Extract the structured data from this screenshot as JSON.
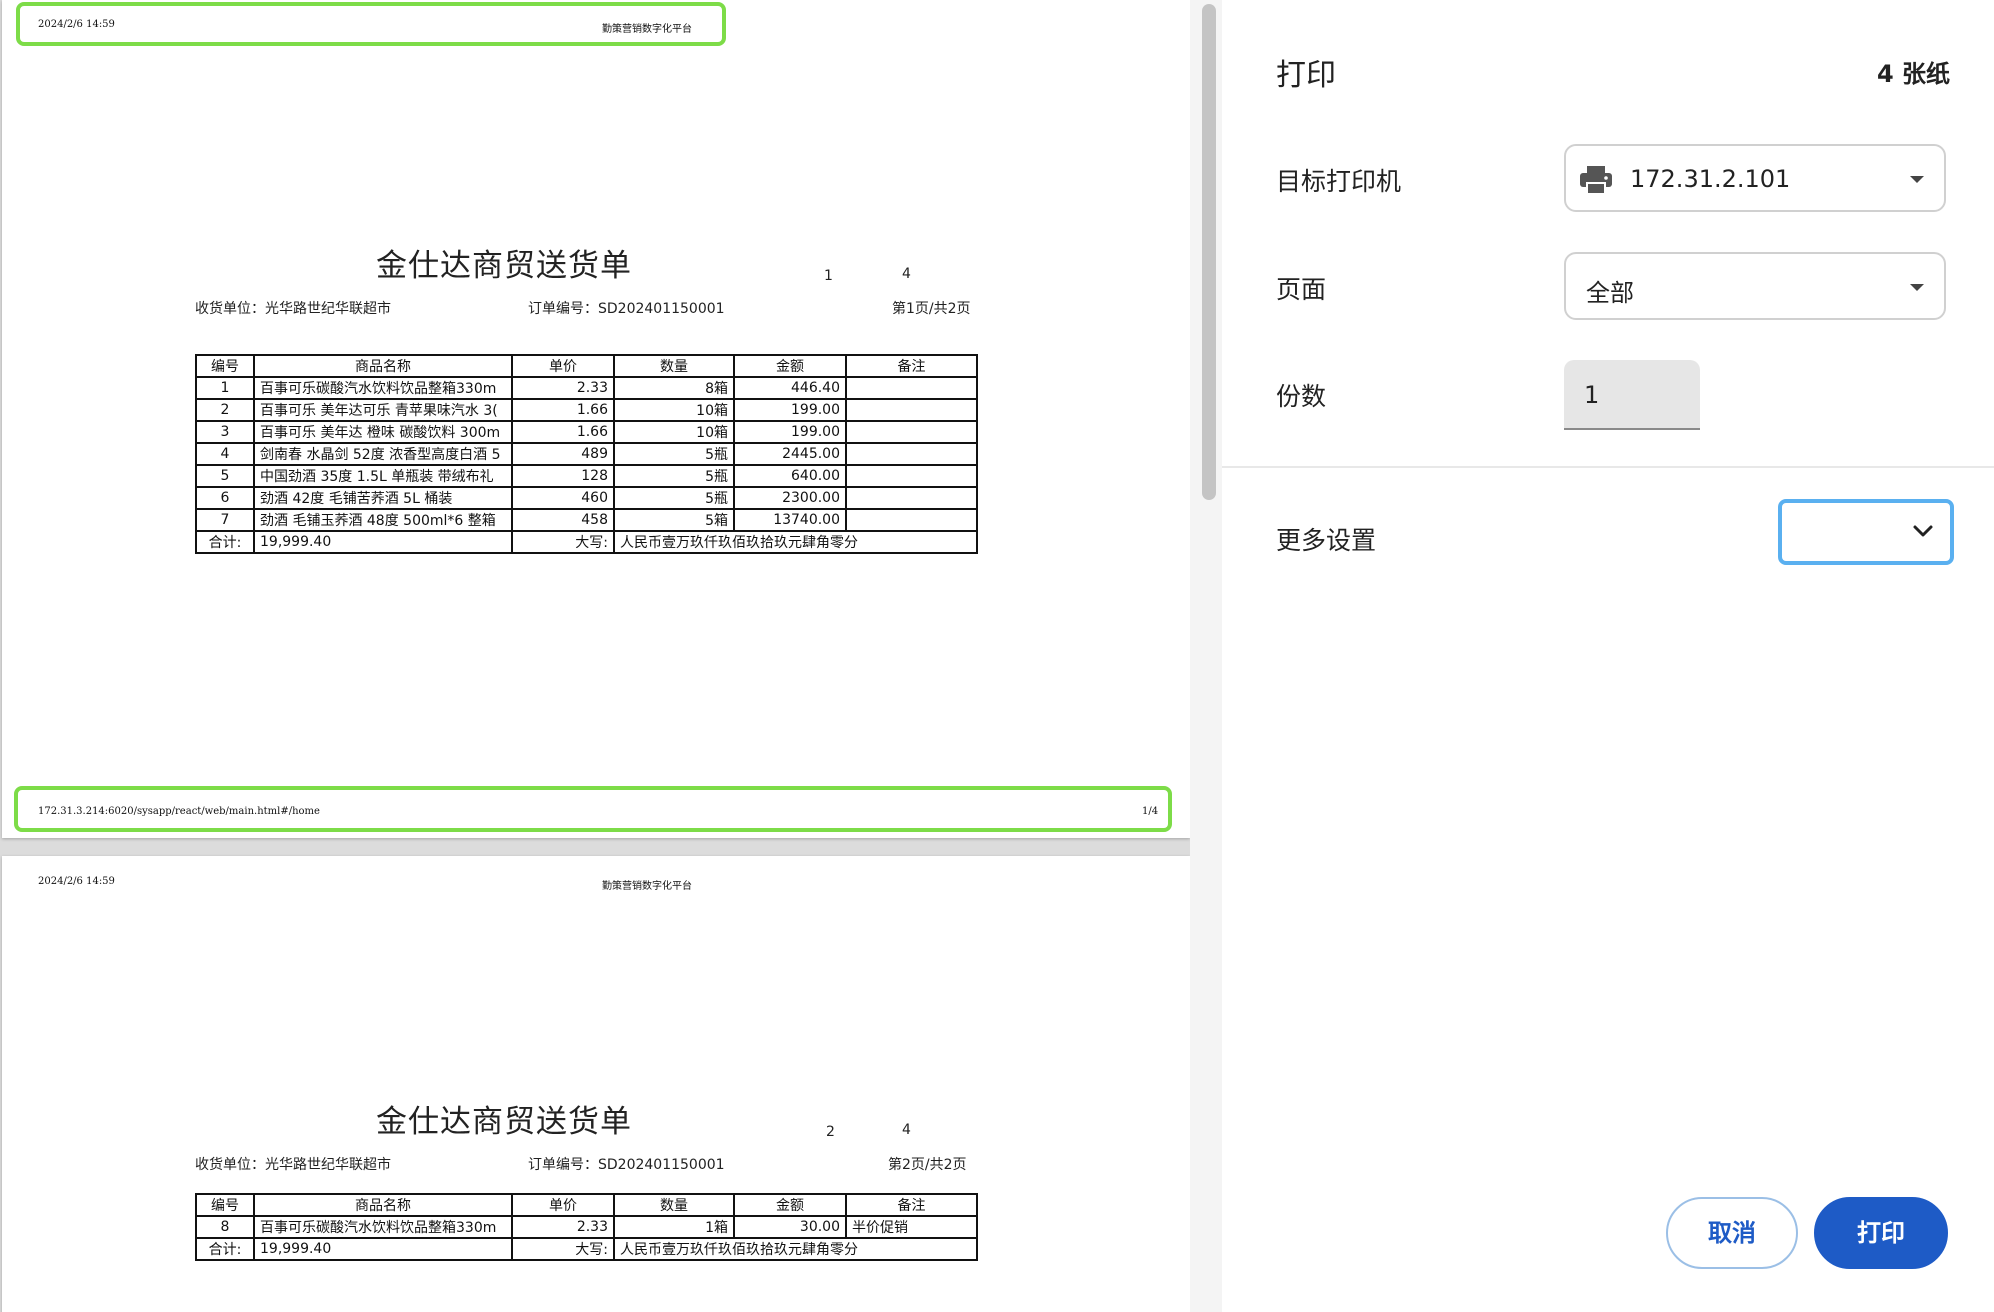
{
  "preview": {
    "pages": [
      {
        "header_date": "2024/2/6 14:59",
        "header_site": "勤策营销数字化平台",
        "title": "金仕达商贸送货单",
        "num_a": "1",
        "num_b": "4",
        "receiver": "收货单位：光华路世纪华联超市",
        "order_no": "订单编号：SD202401150001",
        "page_info": "第1页/共2页",
        "footer_url": "172.31.3.214:6020/sysapp/react/web/main.html#/home",
        "footer_num": "1/4"
      },
      {
        "header_date": "2024/2/6 14:59",
        "header_site": "勤策营销数字化平台",
        "title": "金仕达商贸送货单",
        "num_a": "2",
        "num_b": "4",
        "receiver": "收货单位：光华路世纪华联超市",
        "order_no": "订单编号：SD202401150001",
        "page_info": "第2页/共2页"
      }
    ],
    "table_headers": [
      "编号",
      "商品名称",
      "单价",
      "数量",
      "金额",
      "备注"
    ],
    "rows_page1": [
      [
        "1",
        "百事可乐碳酸汽水饮料饮品整箱330m",
        "2.33",
        "8箱",
        "446.40",
        ""
      ],
      [
        "2",
        "百事可乐 美年达可乐 青苹果味汽水 3(",
        "1.66",
        "10箱",
        "199.00",
        ""
      ],
      [
        "3",
        "百事可乐 美年达 橙味 碳酸饮料 300m",
        "1.66",
        "10箱",
        "199.00",
        ""
      ],
      [
        "4",
        "剑南春 水晶剑 52度 浓香型高度白酒 5",
        "489",
        "5瓶",
        "2445.00",
        ""
      ],
      [
        "5",
        "中国劲酒 35度 1.5L 单瓶装 带绒布礼",
        "128",
        "5瓶",
        "640.00",
        ""
      ],
      [
        "6",
        "劲酒 42度 毛铺苦荞酒 5L 桶装",
        "460",
        "5瓶",
        "2300.00",
        ""
      ],
      [
        "7",
        "劲酒 毛铺玉荞酒 48度 500ml*6 整箱",
        "458",
        "5箱",
        "13740.00",
        ""
      ]
    ],
    "rows_page2": [
      [
        "8",
        "百事可乐碳酸汽水饮料饮品整箱330m",
        "2.33",
        "1箱",
        "30.00",
        "半价促销"
      ]
    ],
    "total_label": "合计:",
    "total_value": "19,999.40",
    "daxie_label": "大写:",
    "daxie_value": "人民币壹万玖仟玖佰玖拾玖元肆角零分"
  },
  "panel": {
    "title": "打印",
    "sheets": "4 张纸",
    "printer_label": "目标打印机",
    "printer_value": "172.31.2.101",
    "printer_icon": "printer-icon",
    "pages_label": "页面",
    "pages_value": "全部",
    "copies_label": "份数",
    "copies_value": "1",
    "more_label": "更多设置",
    "cancel_label": "取消",
    "print_label": "打印"
  },
  "colors": {
    "primary": "#1e5bc6",
    "highlight": "#7ddc48",
    "focus": "#5ab0f0"
  }
}
